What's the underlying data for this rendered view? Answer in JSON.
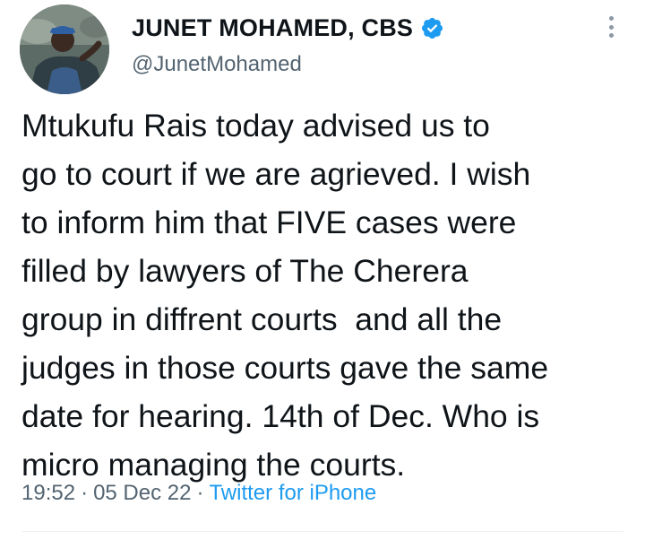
{
  "author": {
    "display_name": "JUNET MOHAMED, CBS",
    "handle": "@JunetMohamed",
    "verified": true,
    "verified_icon": "verified-badge-icon",
    "verified_color": "#1d9bf0"
  },
  "more_icon": "more-vertical-icon",
  "tweet": {
    "lines": [
      "Mtukufu Rais today advised us to",
      "go to court if we are agrieved. I wish",
      "to inform him that FIVE cases were",
      "filled by lawyers of The Cherera",
      "group in diffrent courts  and all the",
      "judges in those courts gave the same",
      "date for hearing. 14th of Dec. Who is",
      "micro managing the courts."
    ]
  },
  "meta": {
    "time": "19:52",
    "separator": "·",
    "date": "05 Dec 22",
    "source": "Twitter for iPhone",
    "source_color": "#1d9bf0"
  }
}
